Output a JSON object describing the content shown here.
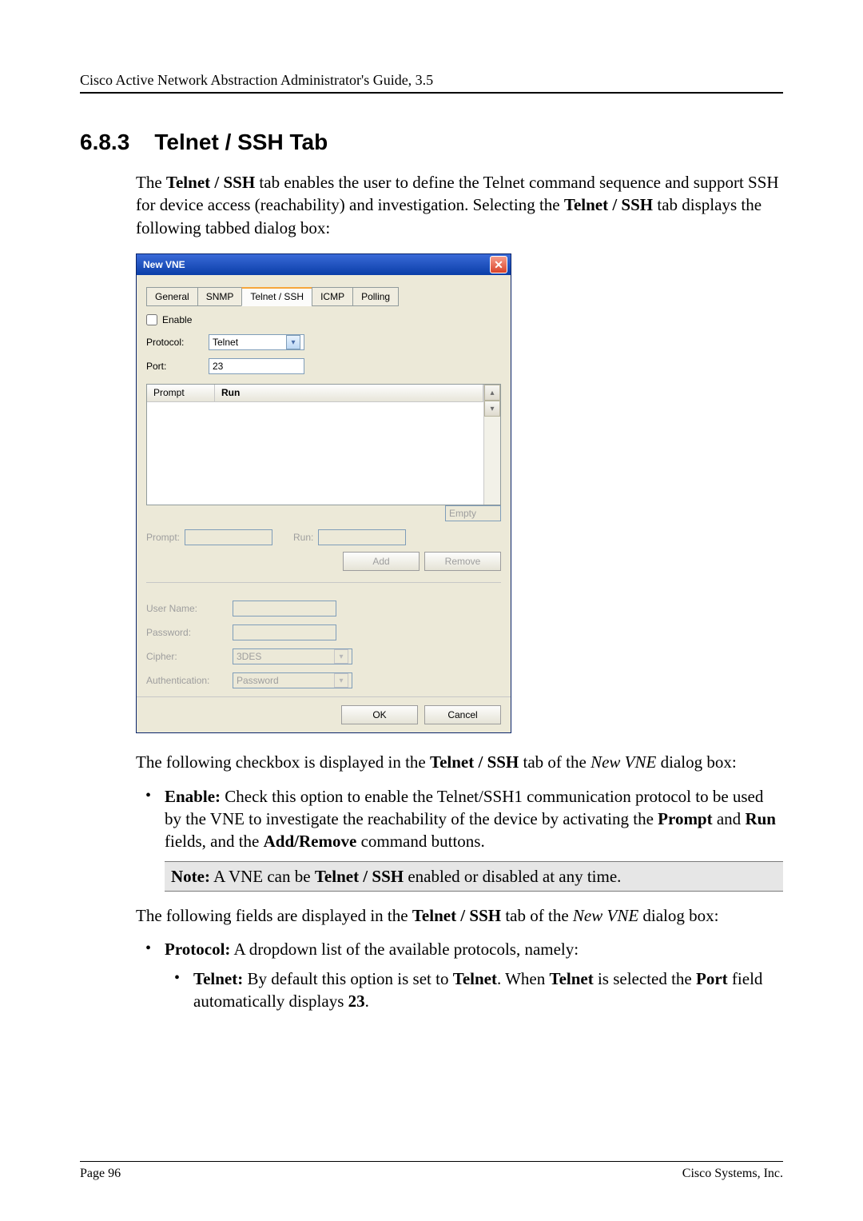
{
  "running_head": "Cisco Active Network Abstraction Administrator's Guide, 3.5",
  "section": {
    "number": "6.8.3",
    "title": "Telnet / SSH Tab"
  },
  "intro": {
    "l1a": "The ",
    "l1b": "Telnet / SSH",
    "l1c": " tab enables the user to define the Telnet command sequence and support SSH for device access (reachability) and investigation. Selecting the ",
    "l1d": "Telnet / SSH",
    "l1e": " tab displays the following tabbed dialog box:"
  },
  "dialog": {
    "title": "New VNE",
    "tabs": {
      "general": "General",
      "snmp": "SNMP",
      "telnet": "Telnet / SSH",
      "icmp": "ICMP",
      "polling": "Polling"
    },
    "enable": "Enable",
    "protocol_label": "Protocol:",
    "protocol_value": "Telnet",
    "port_label": "Port:",
    "port_value": "23",
    "col_prompt": "Prompt",
    "col_run": "Run",
    "empty": "Empty",
    "prompt_label": "Prompt:",
    "run_label": "Run:",
    "add": "Add",
    "remove": "Remove",
    "user_label": "User Name:",
    "pass_label": "Password:",
    "cipher_label": "Cipher:",
    "cipher_value": "3DES",
    "auth_label": "Authentication:",
    "auth_value": "Password",
    "ok": "OK",
    "cancel": "Cancel"
  },
  "after_dialog": {
    "p1a": "The following checkbox is displayed in the ",
    "p1b": "Telnet / SSH",
    "p1c": " tab of the ",
    "p1d": "New VNE",
    "p1e": " dialog box:",
    "enable_b": "Enable:",
    "enable_t1": " Check this option to enable the Telnet/SSH1 communication protocol to be used by the VNE to investigate the reachability of the device by activating the ",
    "enable_b2": "Prompt",
    "enable_t2": " and ",
    "enable_b3": "Run",
    "enable_t3": " fields, and the ",
    "enable_b4": "Add/Remove",
    "enable_t4": " command buttons.",
    "note_b": "Note:",
    "note_t1": " A VNE can be ",
    "note_b2": "Telnet / SSH",
    "note_t2": " enabled or disabled at any time.",
    "p2a": "The following fields are displayed in the ",
    "p2b": "Telnet / SSH",
    "p2c": " tab of the ",
    "p2d": "New VNE",
    "p2e": " dialog box:",
    "proto_b": "Protocol:",
    "proto_t": " A dropdown list of the available protocols, namely:",
    "tel_b": "Telnet:",
    "tel_t1": " By default this option is set to ",
    "tel_b2": "Telnet",
    "tel_t2": ". When ",
    "tel_b3": "Telnet",
    "tel_t3": " is selected the ",
    "tel_b4": "Port",
    "tel_t4": " field automatically displays ",
    "tel_b5": "23",
    "tel_t5": "."
  },
  "footer": {
    "left": "Page 96",
    "right": "Cisco Systems, Inc."
  }
}
